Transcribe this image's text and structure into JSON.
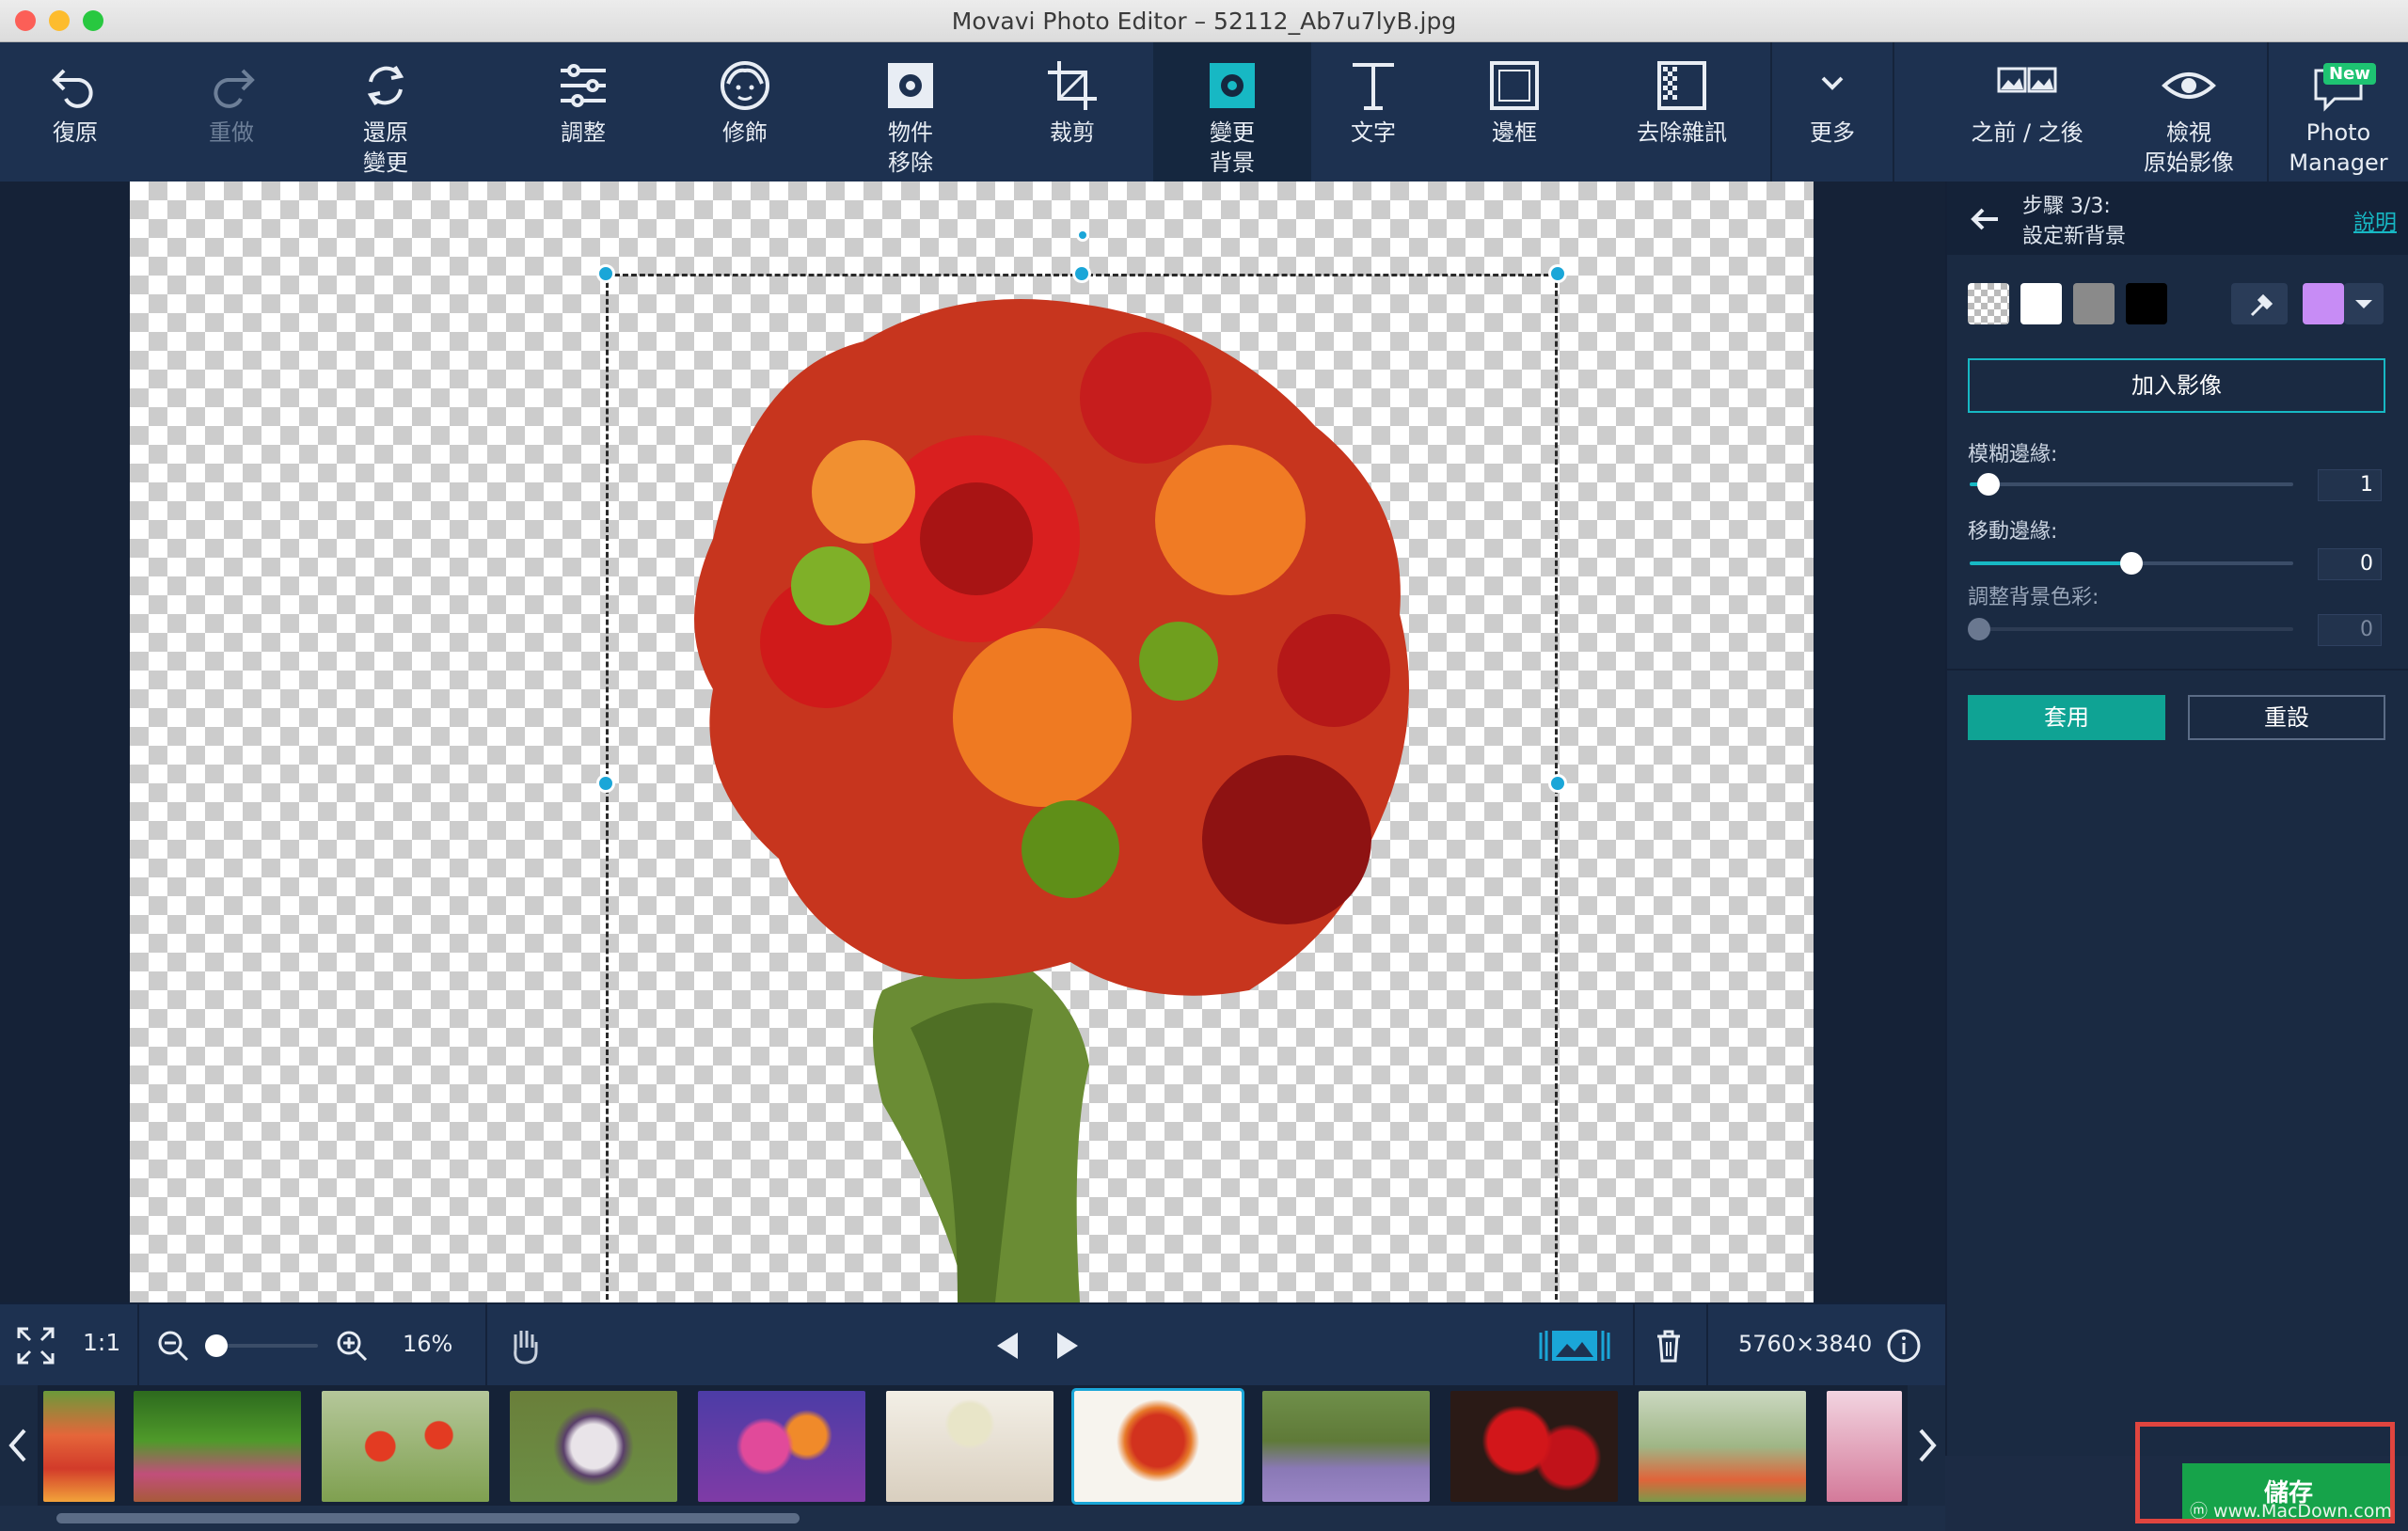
{
  "window": {
    "title": "Movavi Photo Editor – 52112_Ab7u7lyB.jpg"
  },
  "toolbar": {
    "undo": "復原",
    "redo": "重做",
    "restore": "還原\n變更",
    "adjust": "調整",
    "retouch": "修飾",
    "object_removal": "物件\n移除",
    "crop": "裁剪",
    "change_bg": "變更\n背景",
    "text": "文字",
    "frame": "邊框",
    "denoise": "去除雜訊",
    "more": "更多",
    "before_after": "之前 / 之後",
    "view_original": "檢視\n原始影像",
    "photo_manager": "Photo\nManager",
    "new_badge": "New"
  },
  "panel": {
    "step_line1": "步驟 3/3:",
    "step_line2": "設定新背景",
    "help": "說明",
    "add_image": "加入影像",
    "blur_label": "模糊邊緣:",
    "blur_value": "1",
    "shift_label": "移動邊緣:",
    "shift_value": "0",
    "color_label": "調整背景色彩:",
    "color_value": "0",
    "apply": "套用",
    "reset": "重設",
    "swatch_colors": [
      "#ffffff",
      "#8a8a8a",
      "#000000",
      "#c78cf5"
    ]
  },
  "bottom": {
    "one_to_one": "1:1",
    "zoom": "16%",
    "dimensions": "5760×3840"
  },
  "save": {
    "label": "儲存",
    "watermark": "ⓜ www.MacDown.com"
  },
  "colors": {
    "accent": "#17b8c4",
    "toolbar_bg": "#1d3150",
    "panel_bg": "#1a2a42",
    "save_green": "#16a34a"
  }
}
